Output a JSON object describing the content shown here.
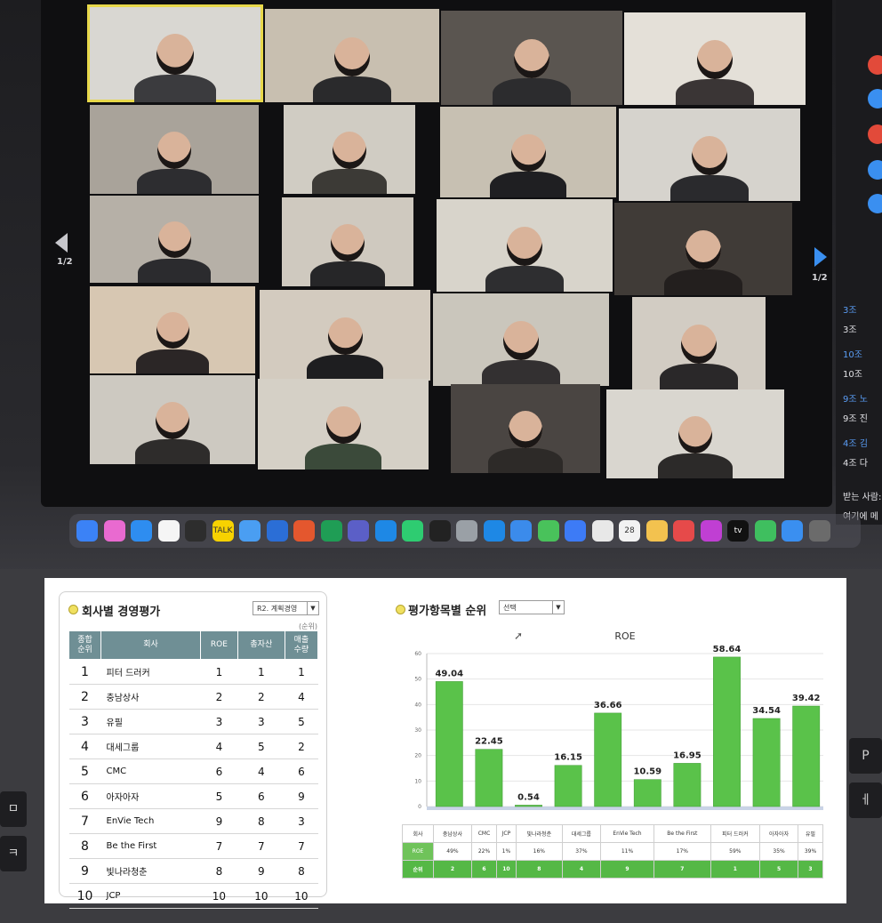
{
  "zoom": {
    "page_indicator_left": "1/2",
    "page_indicator_right": "1/2",
    "chat_items": [
      "3조",
      "3조",
      "10조",
      "10조",
      "9조 노",
      "9조 진",
      "4조 김",
      "4조 다",
      "받는 사람:",
      "여기에 메"
    ],
    "dock_calendar_date": "28",
    "dock_talk_label": "TALK",
    "dock_tv_label": "tv"
  },
  "keyboard_keys": [
    "P",
    "ㅔ",
    "ㅁ",
    "ㅋ"
  ],
  "company_eval": {
    "title": "회사별 경영평가",
    "round_select": "R2. 계획경영",
    "unit_label": "(순위)",
    "headers": [
      "종합\n순위",
      "회사",
      "ROE",
      "총자산",
      "매출\n수량"
    ],
    "rows": [
      {
        "rank": "1",
        "company": "피터 드러커",
        "roe": "1",
        "assets": "1",
        "sales": "1"
      },
      {
        "rank": "2",
        "company": "충남상사",
        "roe": "2",
        "assets": "2",
        "sales": "4"
      },
      {
        "rank": "3",
        "company": "유필",
        "roe": "3",
        "assets": "3",
        "sales": "5"
      },
      {
        "rank": "4",
        "company": "대세그룹",
        "roe": "4",
        "assets": "5",
        "sales": "2"
      },
      {
        "rank": "5",
        "company": "CMC",
        "roe": "6",
        "assets": "4",
        "sales": "6"
      },
      {
        "rank": "6",
        "company": "아자아자",
        "roe": "5",
        "assets": "6",
        "sales": "9"
      },
      {
        "rank": "7",
        "company": "EnVie Tech",
        "roe": "9",
        "assets": "8",
        "sales": "3"
      },
      {
        "rank": "8",
        "company": "Be the First",
        "roe": "7",
        "assets": "7",
        "sales": "7"
      },
      {
        "rank": "9",
        "company": "빛나라청춘",
        "roe": "8",
        "assets": "9",
        "sales": "8"
      },
      {
        "rank": "10",
        "company": "JCP",
        "roe": "10",
        "assets": "10",
        "sales": "10"
      }
    ]
  },
  "item_rank": {
    "title": "평가항목별 순위",
    "select_value": "선택"
  },
  "chart_data": {
    "type": "bar",
    "title": "ROE",
    "categories": [
      "충남상사",
      "CMC",
      "JCP",
      "빛나라청춘",
      "대세그룹",
      "EnVie Tech",
      "Be the First",
      "피터 드러커",
      "아자아자",
      "유필"
    ],
    "values": [
      49.04,
      22.45,
      0.54,
      16.15,
      36.66,
      10.59,
      16.95,
      58.64,
      34.54,
      39.42
    ],
    "value_labels": [
      "49.04",
      "22.45",
      "0.54",
      "16.15",
      "36.66",
      "10.59",
      "16.95",
      "58.64",
      "34.54",
      "39.42"
    ],
    "ylim": [
      0,
      60
    ],
    "yticks": [
      "0",
      "10",
      "20",
      "30",
      "40",
      "50",
      "60"
    ],
    "grid": true,
    "color": "#5ac24a"
  },
  "chart_table": {
    "header_label": "회사",
    "categories": [
      "충남상사",
      "CMC",
      "JCP",
      "빛나라청춘",
      "대세그룹",
      "EnVie Tech",
      "Be the First",
      "피터 드러커",
      "아자아자",
      "유필"
    ],
    "roe_label": "ROE",
    "roe_values": [
      "49%",
      "22%",
      "1%",
      "16%",
      "37%",
      "11%",
      "17%",
      "59%",
      "35%",
      "39%"
    ],
    "rank_label": "순위",
    "rank_values": [
      "2",
      "6",
      "10",
      "8",
      "4",
      "9",
      "7",
      "1",
      "5",
      "3"
    ]
  }
}
